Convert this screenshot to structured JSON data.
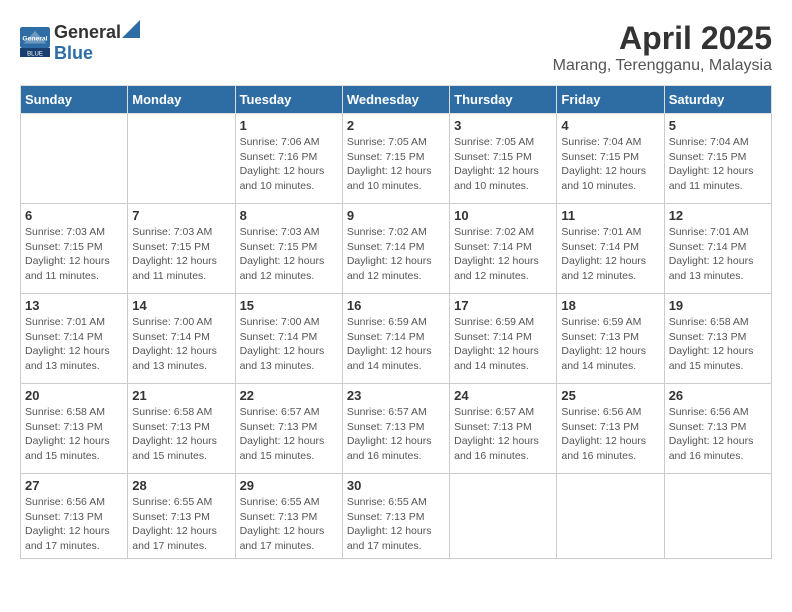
{
  "header": {
    "logo_general": "General",
    "logo_blue": "Blue",
    "month": "April 2025",
    "location": "Marang, Terengganu, Malaysia"
  },
  "columns": [
    "Sunday",
    "Monday",
    "Tuesday",
    "Wednesday",
    "Thursday",
    "Friday",
    "Saturday"
  ],
  "weeks": [
    [
      {
        "day": "",
        "info": ""
      },
      {
        "day": "",
        "info": ""
      },
      {
        "day": "1",
        "info": "Sunrise: 7:06 AM\nSunset: 7:16 PM\nDaylight: 12 hours and 10 minutes."
      },
      {
        "day": "2",
        "info": "Sunrise: 7:05 AM\nSunset: 7:15 PM\nDaylight: 12 hours and 10 minutes."
      },
      {
        "day": "3",
        "info": "Sunrise: 7:05 AM\nSunset: 7:15 PM\nDaylight: 12 hours and 10 minutes."
      },
      {
        "day": "4",
        "info": "Sunrise: 7:04 AM\nSunset: 7:15 PM\nDaylight: 12 hours and 10 minutes."
      },
      {
        "day": "5",
        "info": "Sunrise: 7:04 AM\nSunset: 7:15 PM\nDaylight: 12 hours and 11 minutes."
      }
    ],
    [
      {
        "day": "6",
        "info": "Sunrise: 7:03 AM\nSunset: 7:15 PM\nDaylight: 12 hours and 11 minutes."
      },
      {
        "day": "7",
        "info": "Sunrise: 7:03 AM\nSunset: 7:15 PM\nDaylight: 12 hours and 11 minutes."
      },
      {
        "day": "8",
        "info": "Sunrise: 7:03 AM\nSunset: 7:15 PM\nDaylight: 12 hours and 12 minutes."
      },
      {
        "day": "9",
        "info": "Sunrise: 7:02 AM\nSunset: 7:14 PM\nDaylight: 12 hours and 12 minutes."
      },
      {
        "day": "10",
        "info": "Sunrise: 7:02 AM\nSunset: 7:14 PM\nDaylight: 12 hours and 12 minutes."
      },
      {
        "day": "11",
        "info": "Sunrise: 7:01 AM\nSunset: 7:14 PM\nDaylight: 12 hours and 12 minutes."
      },
      {
        "day": "12",
        "info": "Sunrise: 7:01 AM\nSunset: 7:14 PM\nDaylight: 12 hours and 13 minutes."
      }
    ],
    [
      {
        "day": "13",
        "info": "Sunrise: 7:01 AM\nSunset: 7:14 PM\nDaylight: 12 hours and 13 minutes."
      },
      {
        "day": "14",
        "info": "Sunrise: 7:00 AM\nSunset: 7:14 PM\nDaylight: 12 hours and 13 minutes."
      },
      {
        "day": "15",
        "info": "Sunrise: 7:00 AM\nSunset: 7:14 PM\nDaylight: 12 hours and 13 minutes."
      },
      {
        "day": "16",
        "info": "Sunrise: 6:59 AM\nSunset: 7:14 PM\nDaylight: 12 hours and 14 minutes."
      },
      {
        "day": "17",
        "info": "Sunrise: 6:59 AM\nSunset: 7:14 PM\nDaylight: 12 hours and 14 minutes."
      },
      {
        "day": "18",
        "info": "Sunrise: 6:59 AM\nSunset: 7:13 PM\nDaylight: 12 hours and 14 minutes."
      },
      {
        "day": "19",
        "info": "Sunrise: 6:58 AM\nSunset: 7:13 PM\nDaylight: 12 hours and 15 minutes."
      }
    ],
    [
      {
        "day": "20",
        "info": "Sunrise: 6:58 AM\nSunset: 7:13 PM\nDaylight: 12 hours and 15 minutes."
      },
      {
        "day": "21",
        "info": "Sunrise: 6:58 AM\nSunset: 7:13 PM\nDaylight: 12 hours and 15 minutes."
      },
      {
        "day": "22",
        "info": "Sunrise: 6:57 AM\nSunset: 7:13 PM\nDaylight: 12 hours and 15 minutes."
      },
      {
        "day": "23",
        "info": "Sunrise: 6:57 AM\nSunset: 7:13 PM\nDaylight: 12 hours and 16 minutes."
      },
      {
        "day": "24",
        "info": "Sunrise: 6:57 AM\nSunset: 7:13 PM\nDaylight: 12 hours and 16 minutes."
      },
      {
        "day": "25",
        "info": "Sunrise: 6:56 AM\nSunset: 7:13 PM\nDaylight: 12 hours and 16 minutes."
      },
      {
        "day": "26",
        "info": "Sunrise: 6:56 AM\nSunset: 7:13 PM\nDaylight: 12 hours and 16 minutes."
      }
    ],
    [
      {
        "day": "27",
        "info": "Sunrise: 6:56 AM\nSunset: 7:13 PM\nDaylight: 12 hours and 17 minutes."
      },
      {
        "day": "28",
        "info": "Sunrise: 6:55 AM\nSunset: 7:13 PM\nDaylight: 12 hours and 17 minutes."
      },
      {
        "day": "29",
        "info": "Sunrise: 6:55 AM\nSunset: 7:13 PM\nDaylight: 12 hours and 17 minutes."
      },
      {
        "day": "30",
        "info": "Sunrise: 6:55 AM\nSunset: 7:13 PM\nDaylight: 12 hours and 17 minutes."
      },
      {
        "day": "",
        "info": ""
      },
      {
        "day": "",
        "info": ""
      },
      {
        "day": "",
        "info": ""
      }
    ]
  ]
}
